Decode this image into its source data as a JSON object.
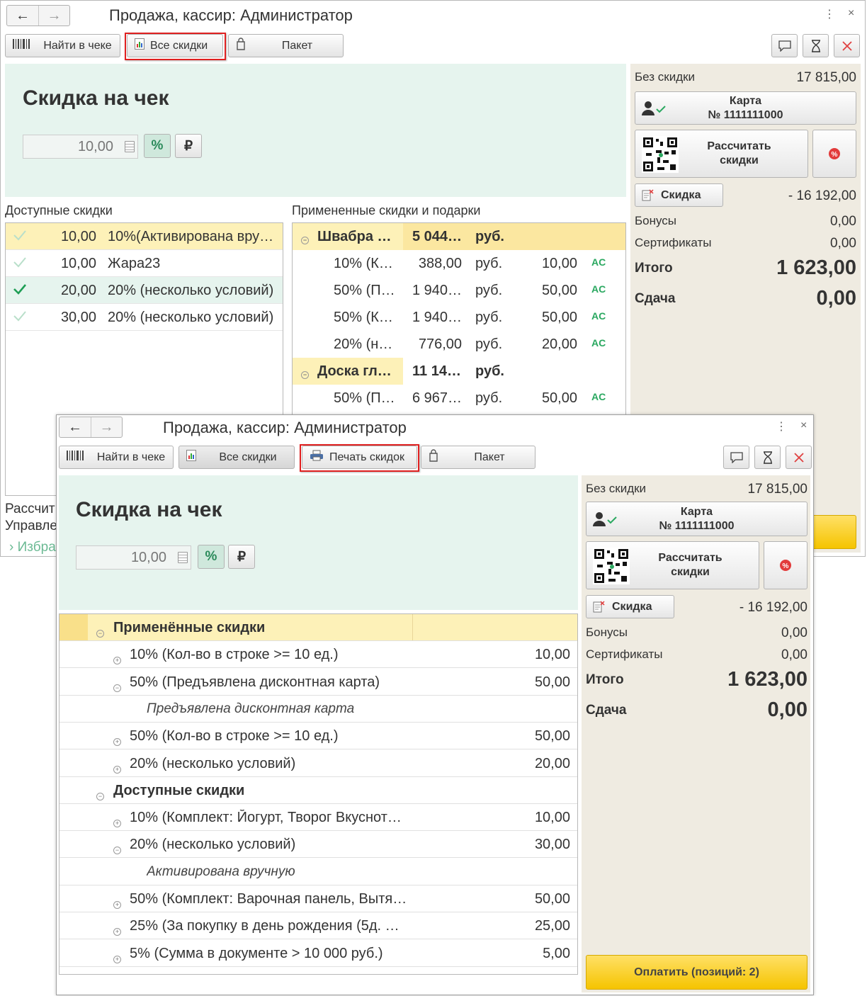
{
  "win1": {
    "title": "Продажа, кассир: Администратор",
    "nav_back": "←",
    "nav_fwd": "→",
    "menu_dots": "⋮",
    "close": "×",
    "toolbar": {
      "find": "Найти в чеке",
      "all_discounts": "Все скидки",
      "package": "Пакет"
    },
    "header": "Скидка на чек",
    "discount_value": "10,00",
    "percent_symbol": "%",
    "ruble_symbol": "₽",
    "available_title": "Доступные скидки",
    "applied_title": "Примененные скидки и подарки",
    "available": [
      {
        "value": "10,00",
        "name": "10%(Активирована вру…",
        "checked": "faint"
      },
      {
        "value": "10,00",
        "name": "Жара23",
        "checked": "faint"
      },
      {
        "value": "20,00",
        "name": "20% (несколько условий)",
        "checked": "strong"
      },
      {
        "value": "30,00",
        "name": "20% (несколько условий)",
        "checked": "faint"
      }
    ],
    "applied": [
      {
        "group": true,
        "name": "Швабра …",
        "sum": "5 044…",
        "cur": "руб."
      },
      {
        "name": "10% (К…",
        "sum": "388,00",
        "cur": "руб.",
        "pct": "10,00",
        "tag": "AC"
      },
      {
        "name": "50% (П…",
        "sum": "1 940…",
        "cur": "руб.",
        "pct": "50,00",
        "tag": "AC"
      },
      {
        "name": "50% (К…",
        "sum": "1 940…",
        "cur": "руб.",
        "pct": "50,00",
        "tag": "AC"
      },
      {
        "name": "20% (н…",
        "sum": "776,00",
        "cur": "руб.",
        "pct": "20,00",
        "tag": "AC"
      },
      {
        "group": true,
        "name": "Доска гл…",
        "sum": "11 14…",
        "cur": "руб."
      },
      {
        "name": "50% (П…",
        "sum": "6 967…",
        "cur": "руб.",
        "pct": "50,00",
        "tag": "AC"
      }
    ],
    "bottom_left_1": "Рассчит",
    "bottom_left_2": "Управле",
    "bottom_left_3": "Избра",
    "side": {
      "no_discount_label": "Без скидки",
      "no_discount_value": "17 815,00",
      "card_label": "Карта",
      "card_number": "№ 1111111000",
      "calc_label_1": "Рассчитать",
      "calc_label_2": "скидки",
      "discount_label": "Скидка",
      "discount_value": "- 16 192,00",
      "bonus_label": "Бонусы",
      "bonus_value": "0,00",
      "cert_label": "Сертификаты",
      "cert_value": "0,00",
      "total_label": "Итого",
      "total_value": "1 623,00",
      "change_label": "Сдача",
      "change_value": "0,00"
    }
  },
  "win2": {
    "title": "Продажа, кассир: Администратор",
    "nav_back": "←",
    "nav_fwd": "→",
    "menu_dots": "⋮",
    "close": "×",
    "toolbar": {
      "find": "Найти в чеке",
      "all_discounts": "Все скидки",
      "print_discounts": "Печать скидок",
      "package": "Пакет"
    },
    "header": "Скидка на чек",
    "discount_value": "10,00",
    "percent_symbol": "%",
    "ruble_symbol": "₽",
    "tree": [
      {
        "level": 0,
        "text": "Применённые скидки",
        "value": "",
        "kind": "group-hl"
      },
      {
        "level": 1,
        "text": "10% (Кол-во в строке >= 10 ед.)",
        "value": "10,00",
        "sign": "+"
      },
      {
        "level": 1,
        "text": "50% (Предъявлена дисконтная карта)",
        "value": "50,00",
        "sign": "−"
      },
      {
        "level": 2,
        "text": "Предъявлена дисконтная карта",
        "value": "",
        "kind": "italic"
      },
      {
        "level": 1,
        "text": "50% (Кол-во в строке >= 10 ед.)",
        "value": "50,00",
        "sign": "+"
      },
      {
        "level": 1,
        "text": "20% (несколько условий)",
        "value": "20,00",
        "sign": "+"
      },
      {
        "level": 0,
        "text": "Доступные скидки",
        "value": "",
        "kind": "group"
      },
      {
        "level": 1,
        "text": "10% (Комплект: Йогурт, Творог Вкуснот…",
        "value": "10,00",
        "sign": "+"
      },
      {
        "level": 1,
        "text": "20% (несколько условий)",
        "value": "30,00",
        "sign": "−"
      },
      {
        "level": 2,
        "text": "Активирована вручную",
        "value": "",
        "kind": "italic"
      },
      {
        "level": 1,
        "text": "50% (Комплект: Варочная панель, Вытя…",
        "value": "50,00",
        "sign": "+"
      },
      {
        "level": 1,
        "text": "25% (За покупку в день рождения (5д. …",
        "value": "25,00",
        "sign": "+"
      },
      {
        "level": 1,
        "text": "5% (Сумма в документе > 10 000 руб.)",
        "value": "5,00",
        "sign": "+"
      }
    ],
    "side": {
      "no_discount_label": "Без скидки",
      "no_discount_value": "17 815,00",
      "card_label": "Карта",
      "card_number": "№ 1111111000",
      "calc_label_1": "Рассчитать",
      "calc_label_2": "скидки",
      "discount_label": "Скидка",
      "discount_value": "- 16 192,00",
      "bonus_label": "Бонусы",
      "bonus_value": "0,00",
      "cert_label": "Сертификаты",
      "cert_value": "0,00",
      "total_label": "Итого",
      "total_value": "1 623,00",
      "change_label": "Сдача",
      "change_value": "0,00",
      "pay_label": "Оплатить (позиций: 2)"
    }
  },
  "colors": {
    "highlight_red": "#e02020",
    "green_panel": "#e6f4ee",
    "side_panel": "#efebe1",
    "yellow_row": "#fdf1b8",
    "pay_yellow": "#f5c400",
    "check_green": "#2aa860"
  }
}
